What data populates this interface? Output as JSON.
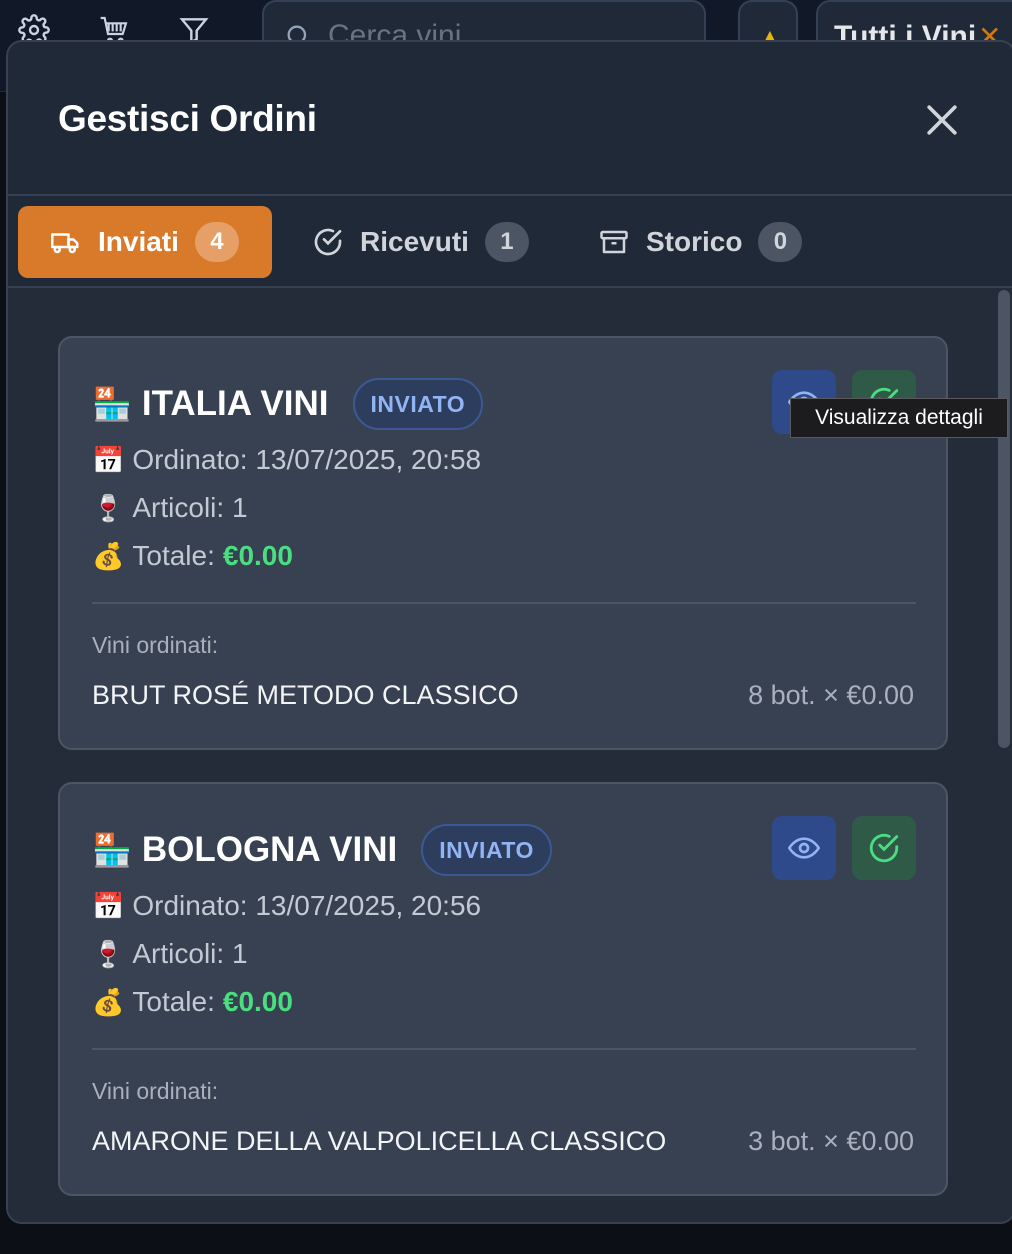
{
  "appbar": {
    "search_placeholder": "Cerca vini",
    "select_label": "Tutti i Vini",
    "icons": [
      "gear-icon",
      "cart-icon",
      "filter-icon",
      "search-icon",
      "warning-icon",
      "chevron-down-icon"
    ]
  },
  "modal": {
    "title": "Gestisci Ordini",
    "tabs": [
      {
        "label": "Inviati",
        "count": "4",
        "icon": "truck-icon",
        "active": true
      },
      {
        "label": "Ricevuti",
        "count": "1",
        "icon": "check-circle-icon",
        "active": false
      },
      {
        "label": "Storico",
        "count": "0",
        "icon": "archive-icon",
        "active": false
      }
    ],
    "orders": [
      {
        "supplier_emoji": "🏪",
        "supplier": "ITALIA VINI",
        "status": "INVIATO",
        "date_emoji": "📅",
        "date": "Ordinato: 13/07/2025, 20:58",
        "items_emoji": "🍷",
        "items": "Articoli: 1",
        "total_emoji": "💰",
        "total_label": "Totale:",
        "total_value": "€0.00",
        "ordered_label": "Vini ordinati:",
        "wines": [
          {
            "name": "BRUT ROSÉ METODO CLASSICO",
            "qty": "8 bot. × €0.00"
          }
        ]
      },
      {
        "supplier_emoji": "🏪",
        "supplier": "BOLOGNA VINI",
        "status": "INVIATO",
        "date_emoji": "📅",
        "date": "Ordinato: 13/07/2025, 20:56",
        "items_emoji": "🍷",
        "items": "Articoli: 1",
        "total_emoji": "💰",
        "total_label": "Totale:",
        "total_value": "€0.00",
        "ordered_label": "Vini ordinati:",
        "wines": [
          {
            "name": "AMARONE DELLA VALPOLICELLA CLASSICO",
            "qty": "3 bot. × €0.00"
          }
        ]
      }
    ],
    "tooltip": "Visualizza dettagli"
  },
  "colors": {
    "accent": "#d97a2b",
    "modal_bg": "#1f2937",
    "card_bg": "#374151",
    "status_blue": "#93b4f4",
    "total_green": "#4ade80"
  }
}
